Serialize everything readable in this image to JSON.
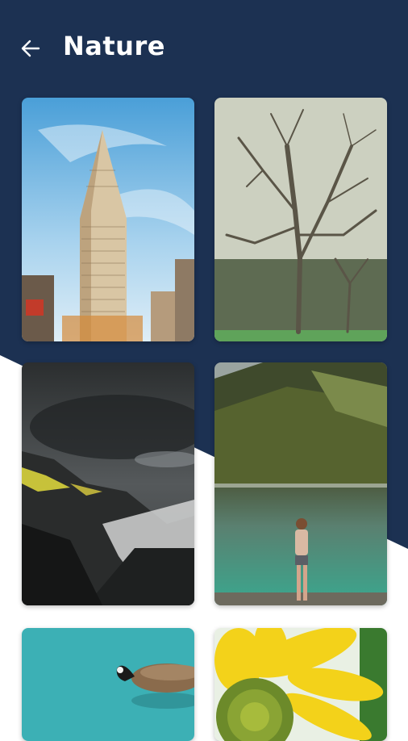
{
  "header": {
    "title": "Nature",
    "back_icon": "arrow-left-icon"
  },
  "colors": {
    "header_bg": "#1c3152",
    "page_bg": "#ffffff",
    "title_text": "#ffffff"
  },
  "gallery": {
    "images": [
      {
        "subject": "flatiron-building"
      },
      {
        "subject": "bare-tree"
      },
      {
        "subject": "stormy-mountains"
      },
      {
        "subject": "woman-at-lake"
      },
      {
        "subject": "goose-swimming"
      },
      {
        "subject": "sunflower"
      }
    ]
  }
}
